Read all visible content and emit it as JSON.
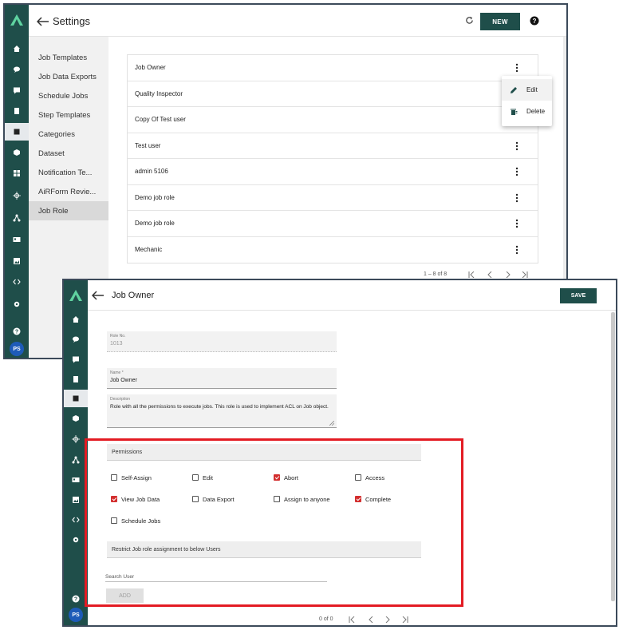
{
  "window1": {
    "title": "Settings",
    "new_label": "NEW",
    "sidebar": [
      {
        "label": "Job Templates",
        "active": false
      },
      {
        "label": "Job Data Exports",
        "active": false
      },
      {
        "label": "Schedule Jobs",
        "active": false
      },
      {
        "label": "Step Templates",
        "active": false
      },
      {
        "label": "Categories",
        "active": false
      },
      {
        "label": "Dataset",
        "active": false
      },
      {
        "label": "Notification Te...",
        "active": false
      },
      {
        "label": "AiRForm Revie...",
        "active": false
      },
      {
        "label": "Job Role",
        "active": true
      }
    ],
    "roles": [
      "Job Owner",
      "Quality Inspector",
      "Copy Of Test user",
      "Test user",
      "admin 5106",
      "Demo job role",
      "Demo job role",
      "Mechanic"
    ],
    "menu": {
      "edit": "Edit",
      "delete": "Delete"
    },
    "pagination": "1 – 8 of 8",
    "avatar": "PS"
  },
  "window2": {
    "title": "Job Owner",
    "save_label": "SAVE",
    "role_no": {
      "label": "Role No.",
      "value": "1013"
    },
    "name": {
      "label": "Name *",
      "value": "Job Owner"
    },
    "description": {
      "label": "Description",
      "value": "Role with all the permissions to execute jobs. This role is used to implement ACL on Job object."
    },
    "permissions_title": "Permissions",
    "permissions": [
      {
        "label": "Self-Assign",
        "checked": false
      },
      {
        "label": "Edit",
        "checked": false
      },
      {
        "label": "Abort",
        "checked": true
      },
      {
        "label": "Access",
        "checked": false
      },
      {
        "label": "View Job Data",
        "checked": true
      },
      {
        "label": "Data Export",
        "checked": false
      },
      {
        "label": "Assign to anyone",
        "checked": false
      },
      {
        "label": "Complete",
        "checked": true
      },
      {
        "label": "Schedule Jobs",
        "checked": false
      }
    ],
    "restrict_title": "Restrict Job role assignment to below Users",
    "search_placeholder": "Search User",
    "add_label": "ADD",
    "pagination": "0 of 0",
    "avatar": "PS"
  },
  "colors": {
    "brand": "#1f4e4a",
    "check": "#d32f2f",
    "highlight": "#e31b23"
  }
}
